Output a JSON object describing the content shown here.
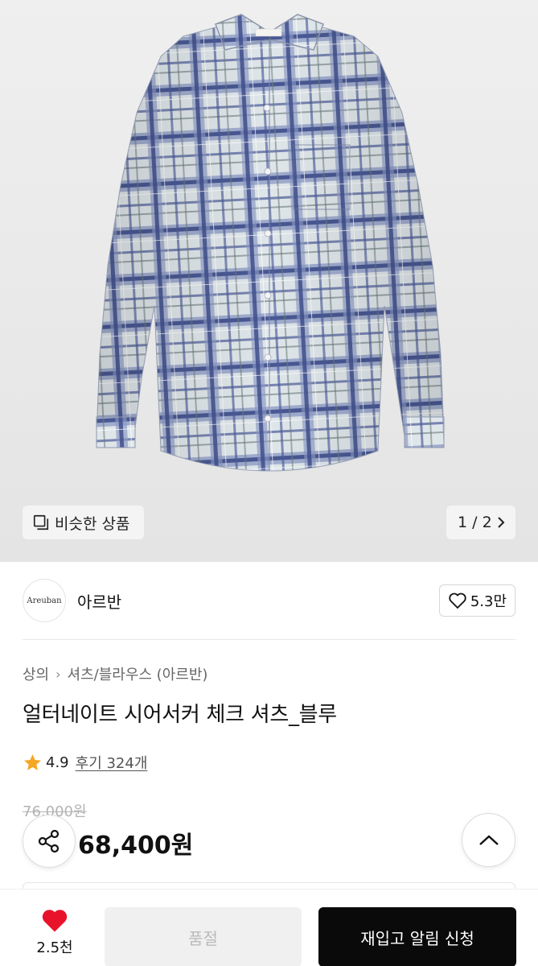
{
  "gallery": {
    "similar_label": "비슷한 상품",
    "pager": "1 / 2",
    "shirt_tag": "Areuban"
  },
  "brand": {
    "logo_text": "Areuban",
    "name": "아르반",
    "likes": "5.3만"
  },
  "breadcrumb": [
    "상의",
    "셔츠/블라우스 (아르반)"
  ],
  "product": {
    "title": "얼터네이트 시어서커 체크 셔츠_블루",
    "rating": "4.9",
    "reviews": "후기 324개",
    "original_price": "76,000원",
    "sale_price": "68,400원"
  },
  "bottom_bar": {
    "wish_count": "2.5천",
    "soldout_label": "품절",
    "restock_label": "재입고 알림 신청"
  },
  "colors": {
    "heart": "#e8132b",
    "star": "#f5a623",
    "cta": "#0a0a0a",
    "plaid_navy": "#3f4f8d",
    "plaid_light": "#dfe6ea"
  },
  "icons": [
    "stack-icon",
    "chevron-right-icon",
    "heart-outline-icon",
    "star-icon",
    "share-icon",
    "chevron-up-icon",
    "heart-filled-icon"
  ]
}
